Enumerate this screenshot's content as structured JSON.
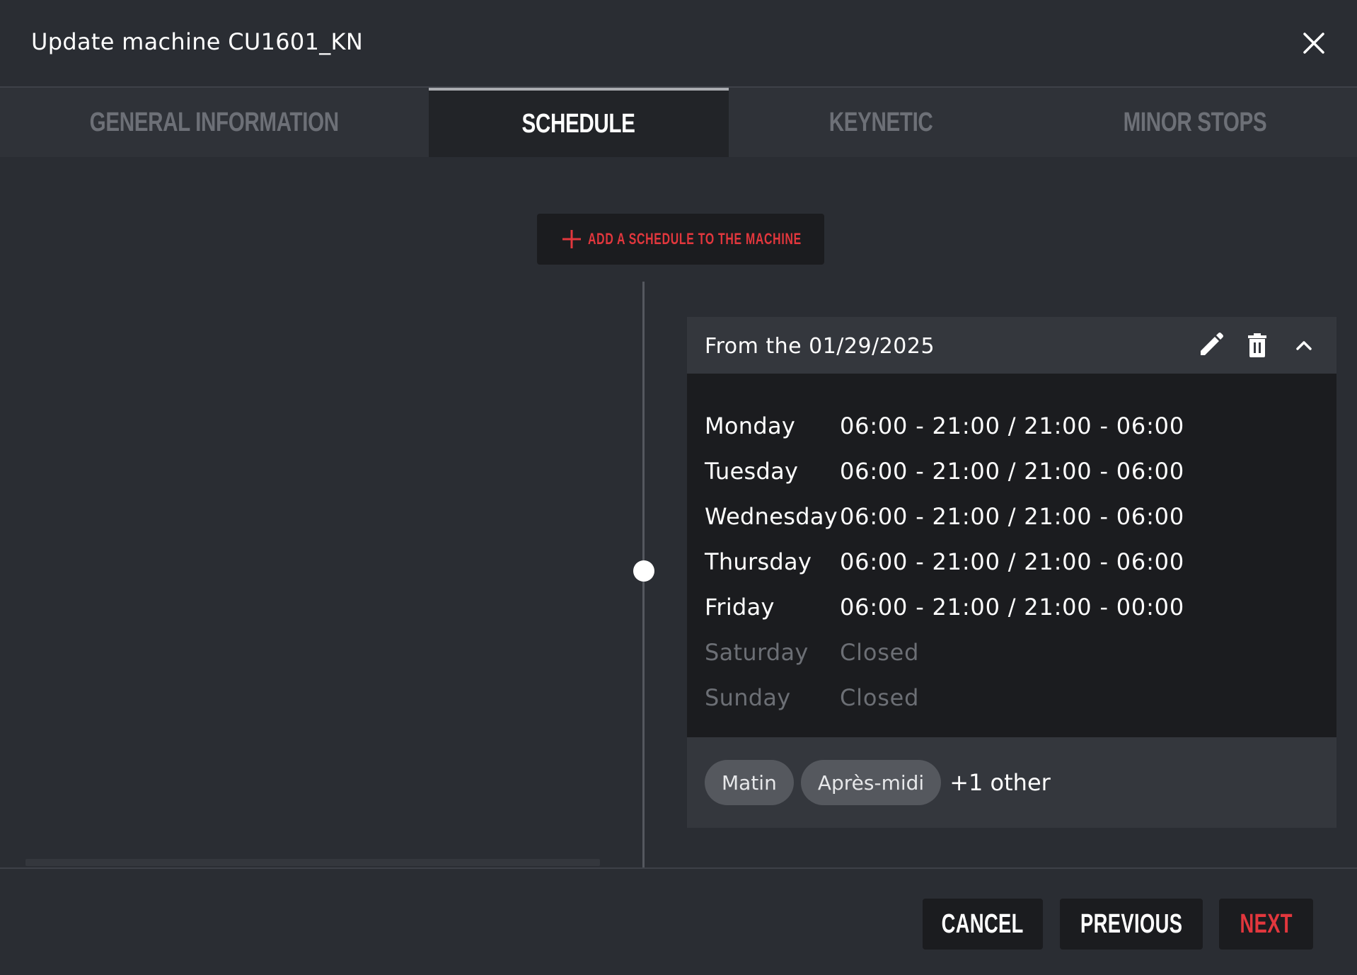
{
  "header": {
    "title": "Update machine CU1601_KN"
  },
  "tabs": [
    {
      "label": "GENERAL INFORMATION",
      "active": false
    },
    {
      "label": "SCHEDULE",
      "active": true
    },
    {
      "label": "KEYNETIC",
      "active": false
    },
    {
      "label": "MINOR STOPS",
      "active": false
    }
  ],
  "schedule": {
    "add_label": "ADD A SCHEDULE TO THE MACHINE",
    "card": {
      "date_label": "From the 01/29/2025",
      "days": [
        {
          "day": "Monday",
          "hours": "06:00 - 21:00 / 21:00 - 06:00"
        },
        {
          "day": "Tuesday",
          "hours": "06:00 - 21:00 / 21:00 - 06:00"
        },
        {
          "day": "Wednesday",
          "hours": "06:00 - 21:00 / 21:00 - 06:00"
        },
        {
          "day": "Thursday",
          "hours": "06:00 - 21:00 / 21:00 - 06:00"
        },
        {
          "day": "Friday",
          "hours": "06:00 - 21:00 / 21:00 - 00:00"
        },
        {
          "day": "Saturday",
          "hours": "Closed"
        },
        {
          "day": "Sunday",
          "hours": "Closed"
        }
      ],
      "shifts": [
        "Matin",
        "Après-midi"
      ],
      "more_label": "+1 other"
    }
  },
  "footer": {
    "cancel_label": "CANCEL",
    "previous_label": "PREVIOUS",
    "next_label": "NEXT"
  },
  "colors": {
    "accent_red": "#e2373d",
    "background": "#2a2d33",
    "panel_dark": "#1b1c1f"
  }
}
